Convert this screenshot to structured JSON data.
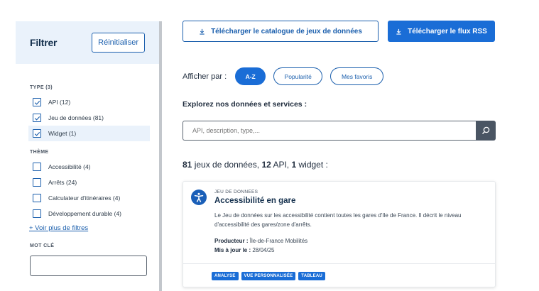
{
  "sidebar": {
    "title": "Filtrer",
    "reset_label": "Réinitialiser",
    "type_section": {
      "label": "TYPE (3)",
      "options": [
        {
          "label": "API (12)",
          "checked": true
        },
        {
          "label": "Jeu de données (81)",
          "checked": true
        },
        {
          "label": "Widget (1)",
          "checked": true
        }
      ]
    },
    "theme_section": {
      "label": "THÈME",
      "options": [
        {
          "label": "Accessibilité (4)",
          "checked": false
        },
        {
          "label": "Arrêts (24)",
          "checked": false
        },
        {
          "label": "Calculateur d'itinéraires (4)",
          "checked": false
        },
        {
          "label": "Développement durable (4)",
          "checked": false
        }
      ]
    },
    "more_filters_label": "+ Voir plus de filtres",
    "keyword_section": {
      "label": "MOT CLÉ",
      "value": ""
    }
  },
  "toolbar": {
    "download_catalog_label": "Télécharger le catalogue de jeux de données",
    "download_rss_label": "Télécharger le flux RSS"
  },
  "sort": {
    "label": "Afficher par :",
    "options": [
      {
        "label": "A-Z",
        "active": true
      },
      {
        "label": "Popularité",
        "active": false
      },
      {
        "label": "Mes favoris",
        "active": false
      }
    ]
  },
  "explore_heading": "Explorez nos données et services :",
  "search": {
    "placeholder": "API, description, type,...",
    "value": ""
  },
  "results": {
    "datasets_count": "81",
    "datasets_text": " jeux de données, ",
    "api_count": "12",
    "api_text": " API, ",
    "widget_count": "1",
    "widget_text": " widget :"
  },
  "card": {
    "type": "JEU DE DONNEES",
    "title": "Accessibilité en gare",
    "description": "Le Jeu de données sur les accessibilité contient toutes les gares d'Ile de France. Il décrit le niveau d'accessibilité des gares/zone d'arrêts.",
    "producer_label": "Producteur :",
    "producer_value": "Île-de-France Mobilités",
    "updated_label": "Mis à jour le :",
    "updated_value": "28/04/25",
    "tags": [
      "ANALYSE",
      "VUE PERSONNALISÉE",
      "TABLEAU"
    ],
    "icon": "accessibility-icon"
  },
  "colors": {
    "primary": "#1a6dd6",
    "primary_dark": "#1b5fad",
    "filter_header_bg": "#eaf2fb",
    "search_button_bg": "#4a5563"
  }
}
